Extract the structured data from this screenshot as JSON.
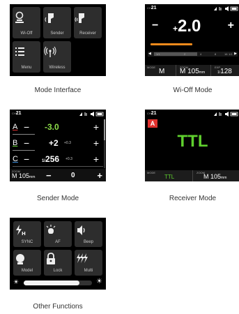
{
  "captions": {
    "mode": "Mode Interface",
    "wioff": "Wi-Off Mode",
    "sender": "Sender Mode",
    "receiver": "Receiver Mode",
    "other": "Other Functions"
  },
  "mode_interface": {
    "tiles": [
      {
        "label": "Wi-Off",
        "icon": "wi-off-icon"
      },
      {
        "label": "Sender",
        "icon": "sender-icon"
      },
      {
        "label": "Receiver",
        "icon": "receiver-icon"
      },
      {
        "label": "Menu",
        "icon": "menu-icon"
      },
      {
        "label": "Wireless",
        "icon": "wireless-icon"
      }
    ]
  },
  "status": {
    "channel_prefix": "CH",
    "channel": "21"
  },
  "wioff_mode": {
    "minus": "−",
    "plus": "+",
    "value_prefix": "+",
    "value": "2.0",
    "scale": [
      "1/1",
      "2",
      "4",
      "8",
      "16",
      "1/1"
    ],
    "mode_label": "MODE",
    "mode_value": "M",
    "zoom_label": "ZOOM",
    "zoom_value": "105",
    "zoom_unit": "mm",
    "exp_label": "EXP",
    "exp_value": "128",
    "exp_prefix": "1/",
    "accent": "#f08a1c"
  },
  "sender_mode": {
    "groups": [
      {
        "letter": "A",
        "minus": "−",
        "value": "-3.0",
        "sub": "",
        "plus": "+",
        "color": "#8fe04a"
      },
      {
        "letter": "B",
        "minus": "−",
        "value": "+2",
        "sub": "+0.3",
        "plus": "+",
        "color": "#ffffff"
      },
      {
        "letter": "C",
        "minus": "−",
        "prefix": "1/",
        "value": "256",
        "sub": "+0.3",
        "plus": "+",
        "color": "#ffffff"
      }
    ],
    "zoom_label": "ZOOM",
    "zoom_value": "105",
    "zoom_unit": "mm",
    "mode_value": "M",
    "minus": "−",
    "center_value": "0",
    "plus": "+"
  },
  "receiver_mode": {
    "group": "A",
    "value": "TTL",
    "mode_label": "MODE",
    "mode_value": "TTL",
    "zoom_label": "ZOOM",
    "zoom_value": "105",
    "zoom_unit": "mm",
    "green": "#5fcf2e",
    "red": "#e0312e"
  },
  "other_functions": {
    "tiles": [
      {
        "label": "SYNC",
        "icon": "sync-high-speed-icon"
      },
      {
        "label": "AF",
        "icon": "af-assist-icon"
      },
      {
        "label": "Beep",
        "icon": "beep-speaker-icon"
      },
      {
        "label": "Model",
        "icon": "model-light-icon"
      },
      {
        "label": "Lock",
        "icon": "lock-icon"
      },
      {
        "label": "Multi",
        "icon": "multi-flash-icon"
      }
    ],
    "brightness": 0.82
  }
}
